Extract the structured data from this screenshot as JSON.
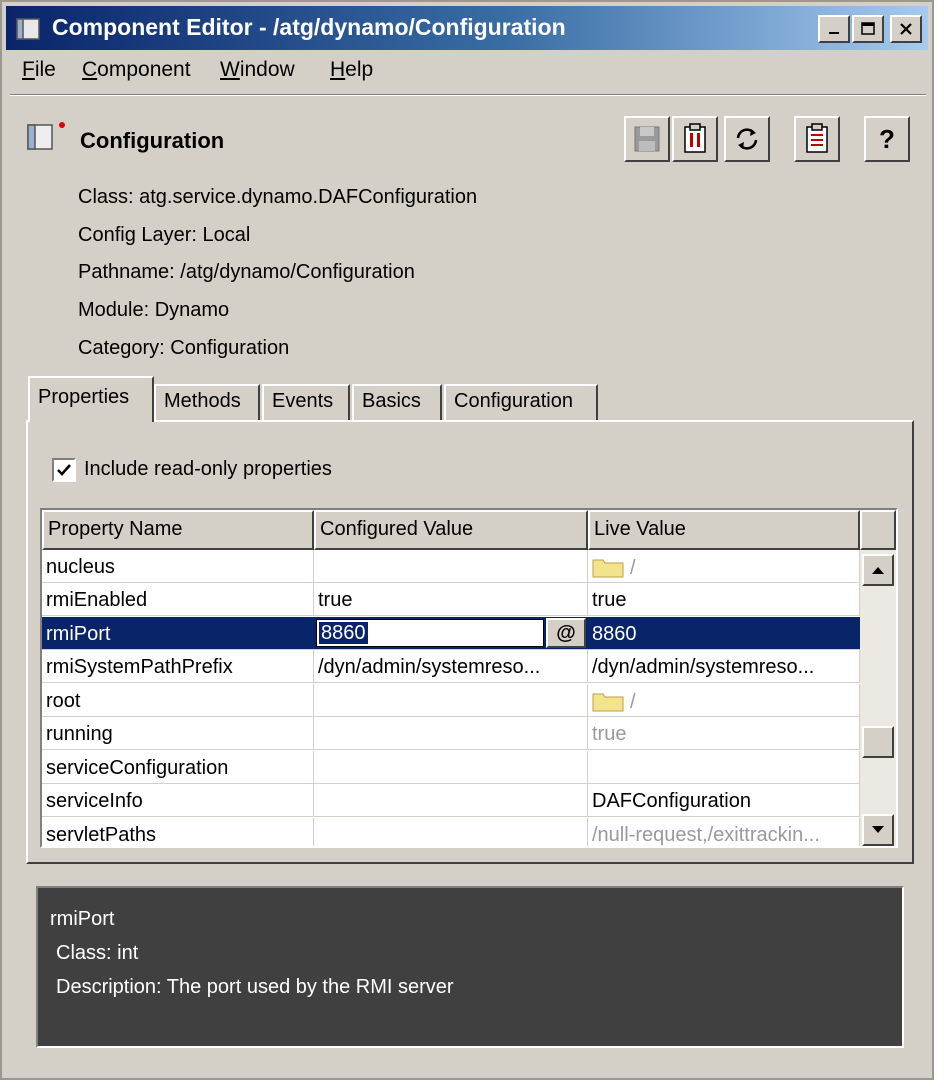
{
  "window": {
    "title": "Component Editor - /atg/dynamo/Configuration",
    "minimize": "_",
    "maximize": "□",
    "close": "✕"
  },
  "menu": {
    "items": [
      {
        "label": "File",
        "mnemonic": "F",
        "rest": "ile"
      },
      {
        "label": "Component",
        "mnemonic": "C",
        "rest": "omponent"
      },
      {
        "label": "Window",
        "mnemonic": "W",
        "rest": "indow"
      },
      {
        "label": "Help",
        "mnemonic": "H",
        "rest": "elp"
      }
    ]
  },
  "component": {
    "name": "Configuration",
    "class": "Class: atg.service.dynamo.DAFConfiguration",
    "config_layer": "Config Layer: Local",
    "pathname": "Pathname: /atg/dynamo/Configuration",
    "module": "Module: Dynamo",
    "category": "Category: Configuration"
  },
  "toolbar": {
    "save_icon": "save-icon",
    "stop_icon": "stop-icon",
    "refresh_icon": "refresh-icon",
    "clipboard_icon": "clipboard-icon",
    "help_label": "?"
  },
  "tabs": [
    {
      "label": "Properties",
      "active": true
    },
    {
      "label": "Methods"
    },
    {
      "label": "Events"
    },
    {
      "label": "Basics"
    },
    {
      "label": "Configuration"
    }
  ],
  "properties": {
    "include_readonly_label": "Include read-only properties",
    "include_readonly_checked": true,
    "columns": [
      "Property Name",
      "Configured Value",
      "Live Value"
    ],
    "rows": [
      {
        "name": "nucleus",
        "configured": "",
        "live": "/",
        "live_folder": true
      },
      {
        "name": "rmiEnabled",
        "configured": "true",
        "live": "true"
      },
      {
        "name": "rmiPort",
        "configured": "8860",
        "live": "8860",
        "selected": true,
        "editor_button": "@"
      },
      {
        "name": "rmiSystemPathPrefix",
        "configured": "/dyn/admin/systemreso...",
        "live": "/dyn/admin/systemreso..."
      },
      {
        "name": "root",
        "configured": "",
        "live": "/",
        "live_folder": true
      },
      {
        "name": "running",
        "configured": "",
        "live": "true",
        "live_grey": true
      },
      {
        "name": "serviceConfiguration",
        "configured": "",
        "live": ""
      },
      {
        "name": "serviceInfo",
        "configured": "",
        "live": "DAFConfiguration"
      },
      {
        "name": "servletPaths",
        "configured": "",
        "live": "/null-request,/exittrackin...",
        "live_grey": true
      }
    ]
  },
  "description": {
    "property": "rmiPort",
    "class": "Class: int",
    "text": "Description: The port used by the RMI server"
  },
  "colors": {
    "selection": "#0a246a",
    "face": "#d4d0c8",
    "desc_bg": "#404040"
  }
}
